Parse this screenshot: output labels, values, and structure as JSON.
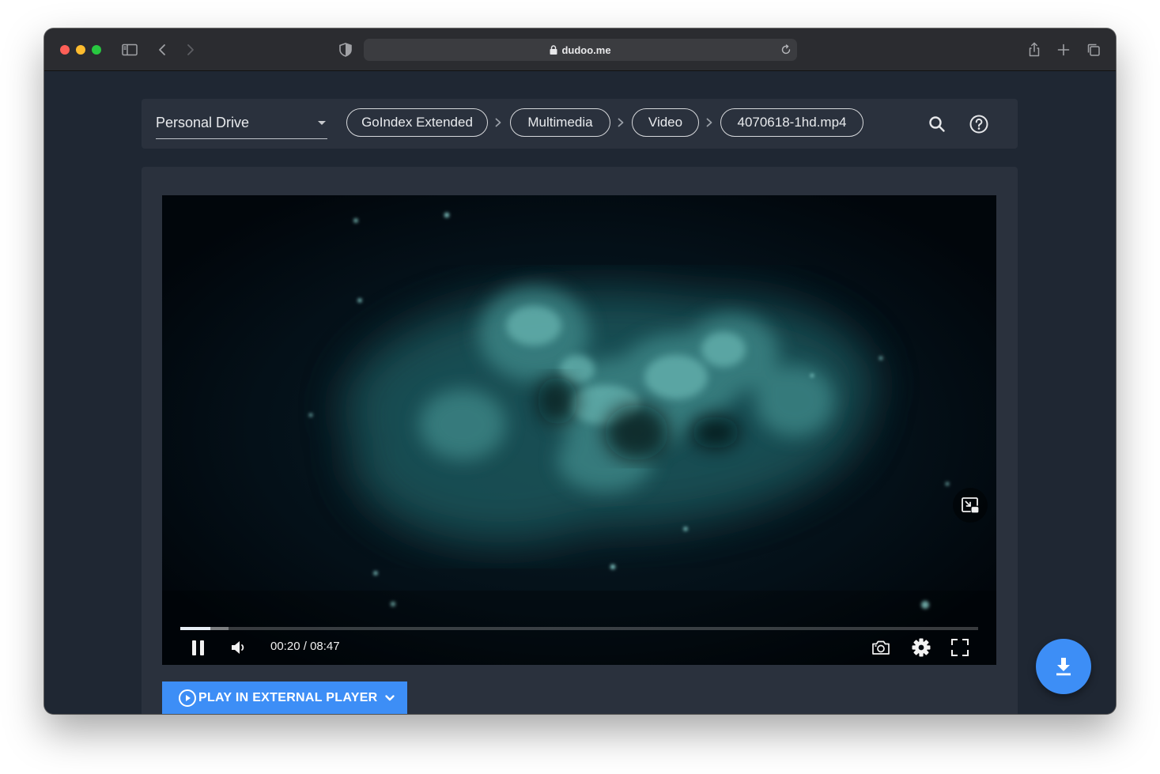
{
  "browser": {
    "url": "dudoo.me",
    "icons": [
      "sidebar-icon",
      "back-icon",
      "forward-icon",
      "shield-icon",
      "lock-icon",
      "reload-icon",
      "share-icon",
      "new-tab-icon",
      "tabs-overview-icon"
    ]
  },
  "navbar": {
    "drive_select": "Personal Drive",
    "breadcrumbs": [
      "GoIndex Extended",
      "Multimedia",
      "Video",
      "4070618-1hd.mp4"
    ],
    "icons": [
      "search-icon",
      "help-icon"
    ]
  },
  "player": {
    "current_time": "00:20",
    "duration": "08:47",
    "time_display": "00:20 / 08:47",
    "progress_fraction": 0.038,
    "state": "playing",
    "icons": [
      "pause-icon",
      "volume-icon",
      "screenshot-icon",
      "settings-icon",
      "fullscreen-icon",
      "picture-in-picture-icon"
    ]
  },
  "actions": {
    "external_player_label": "PLAY IN EXTERNAL PLAYER",
    "download_icon": "download-icon"
  },
  "colors": {
    "page_bg": "#1f2733",
    "panel_bg": "#2a313d",
    "accent": "#3d8ef6",
    "browser_chrome": "#2b2c30"
  }
}
